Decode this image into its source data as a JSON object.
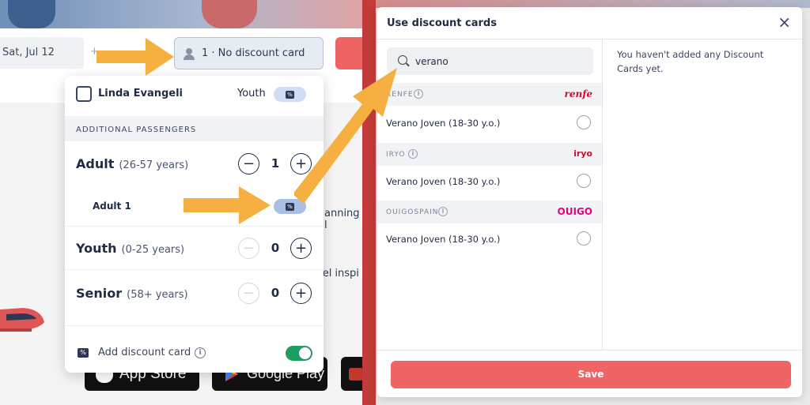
{
  "background": {
    "date_value": "Sat, Jul 12",
    "plus_mark": "+",
    "passenger_summary": "1 · No discount card",
    "partial_text_1": "anning l",
    "partial_text_2": "vel inspi",
    "app_store_label": "App Store",
    "google_play_label": "Google Play"
  },
  "passengers": {
    "user": {
      "name": "Linda Evangeli",
      "type": "Youth"
    },
    "section_heading": "ADDITIONAL PASSENGERS",
    "rows": [
      {
        "title": "Adult",
        "range": "(26-57 years)",
        "count": "1"
      },
      {
        "title": "Youth",
        "range": "(0-25 years)",
        "count": "0"
      },
      {
        "title": "Senior",
        "range": "(58+ years)",
        "count": "0"
      }
    ],
    "adult_sub_label": "Adult 1",
    "add_discount_label": "Add discount card",
    "add_discount_enabled": true,
    "minus_symbol": "−",
    "plus_symbol": "+",
    "percent_symbol": "%",
    "info_symbol": "i"
  },
  "modal": {
    "title": "Use discount cards",
    "close_symbol": "×",
    "search_value": "verano",
    "empty_message": "You haven't added any Discount Cards yet.",
    "operators": [
      {
        "name": "RENFE",
        "logo": "renfe",
        "logo_color": "#c8102e",
        "cards": [
          "Verano Joven (18-30 y.o.)"
        ]
      },
      {
        "name": "IRYO",
        "logo": "iryo",
        "logo_color": "#c8102e",
        "cards": [
          "Verano Joven (18-30 y.o.)"
        ]
      },
      {
        "name": "OUIGOSPAIN",
        "logo": "OUIGO",
        "logo_color": "#e4007d",
        "cards": [
          "Verano Joven (18-30 y.o.)"
        ]
      }
    ],
    "save_label": "Save"
  },
  "colors": {
    "accent_red": "#ef6464",
    "toggle_green": "#1f9c62",
    "arrow_orange": "#f5b041",
    "divider_red": "#c23a3a"
  }
}
